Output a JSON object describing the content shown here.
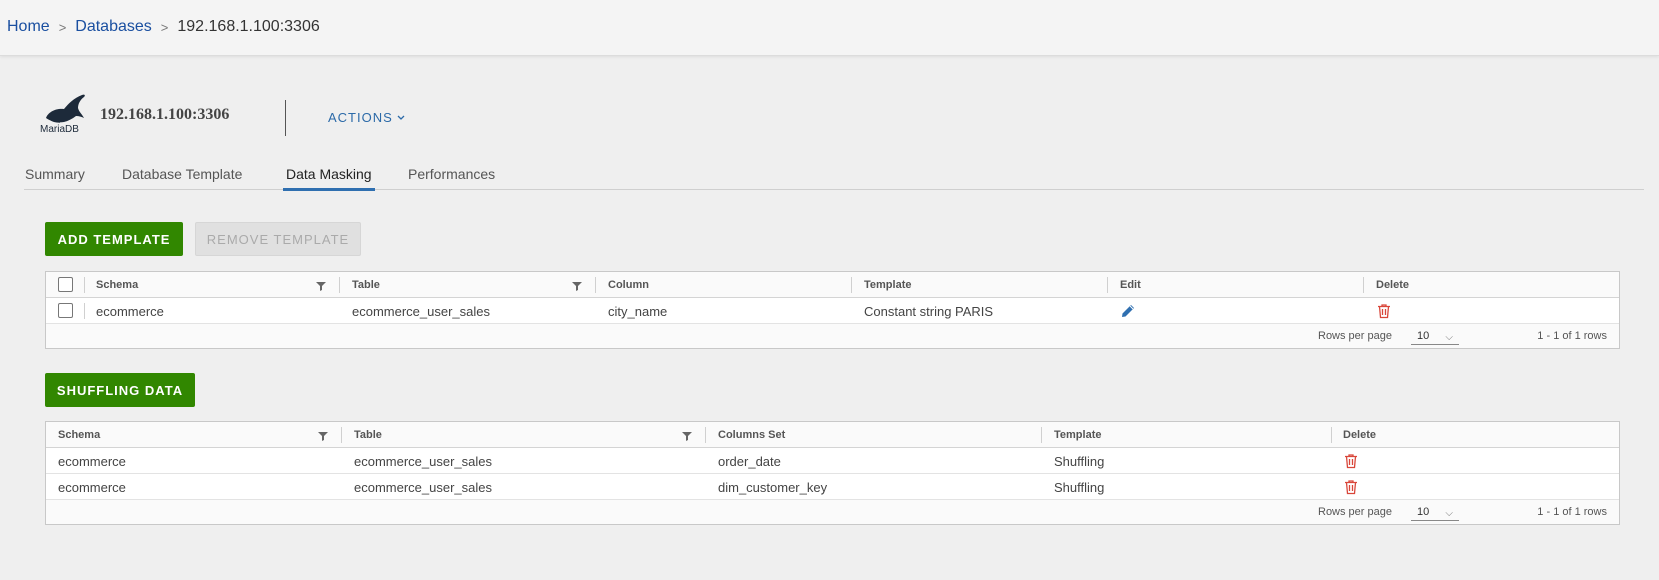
{
  "breadcrumb": {
    "home": "Home",
    "databases": "Databases",
    "current": "192.168.1.100:3306",
    "separator": ">"
  },
  "header": {
    "logo_text": "MariaDB",
    "title": "192.168.1.100:3306",
    "actions_label": "ACTIONS"
  },
  "tabs": [
    {
      "label": "Summary"
    },
    {
      "label": "Database Template"
    },
    {
      "label": "Data Masking"
    },
    {
      "label": "Performances"
    }
  ],
  "active_tab": "Data Masking",
  "masking": {
    "add_label": "ADD TEMPLATE",
    "remove_label": "REMOVE TEMPLATE",
    "columns": {
      "schema": "Schema",
      "table": "Table",
      "column": "Column",
      "template": "Template",
      "edit": "Edit",
      "delete": "Delete"
    },
    "rows": [
      {
        "schema": "ecommerce",
        "table": "ecommerce_user_sales",
        "column": "city_name",
        "template": "Constant string PARIS"
      }
    ],
    "footer": {
      "rows_per_page_label": "Rows per page",
      "rows_per_page": "10",
      "pagination": "1 - 1 of 1 rows"
    }
  },
  "shuffling": {
    "button_label": "SHUFFLING DATA",
    "columns": {
      "schema": "Schema",
      "table": "Table",
      "columns_set": "Columns Set",
      "template": "Template",
      "delete": "Delete"
    },
    "rows": [
      {
        "schema": "ecommerce",
        "table": "ecommerce_user_sales",
        "columns_set": "order_date",
        "template": "Shuffling"
      },
      {
        "schema": "ecommerce",
        "table": "ecommerce_user_sales",
        "columns_set": "dim_customer_key",
        "template": "Shuffling"
      }
    ],
    "footer": {
      "rows_per_page_label": "Rows per page",
      "rows_per_page": "10",
      "pagination": "1 - 1 of 1 rows"
    }
  },
  "colors": {
    "primary": "#318700",
    "link": "#1a4fa0",
    "delete": "#d9463a",
    "edit": "#2f6fb0",
    "tab_underline": "#2f6fb0"
  },
  "icons": {
    "filter": "filter-icon",
    "edit": "pencil-icon",
    "delete": "trash-icon",
    "chevron": "chevron-down-icon"
  }
}
